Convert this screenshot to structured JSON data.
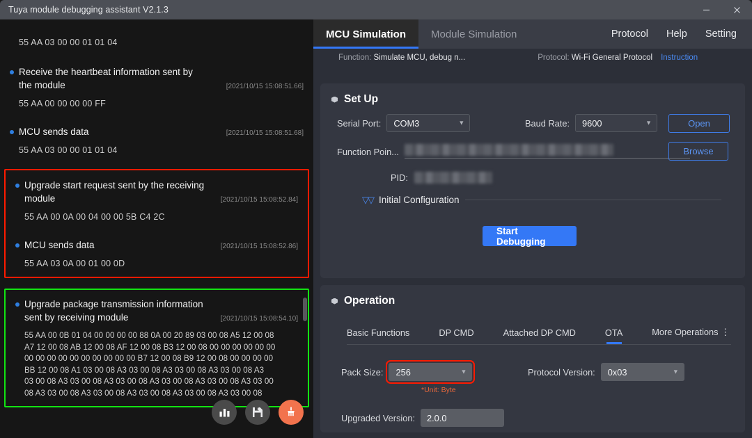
{
  "window": {
    "title": "Tuya module debugging assistant V2.1.3",
    "minimize_label": "minimize",
    "close_label": "close"
  },
  "log": {
    "entries": [
      {
        "type": "data-only",
        "body": "55 AA 03 00 00 01 01 04",
        "highlight": "none"
      },
      {
        "type": "entry",
        "head": "Receive the heartbeat information sent by the module",
        "timestamp": "[2021/10/15 15:08:51.66]",
        "body": "55 AA 00 00 00 00 FF",
        "highlight": "none"
      },
      {
        "type": "entry",
        "head": "MCU sends data",
        "timestamp": "[2021/10/15 15:08:51.68]",
        "body": "55 AA 03 00 00 01 01 04",
        "highlight": "none"
      },
      {
        "type": "entry",
        "head": "Upgrade start request sent by the receiving module",
        "timestamp": "[2021/10/15 15:08:52.84]",
        "body": "55 AA 00 0A 00 04 00 00 5B C4 2C",
        "highlight": "red"
      },
      {
        "type": "entry",
        "head": "MCU sends data",
        "timestamp": "[2021/10/15 15:08:52.86]",
        "body": "55 AA 03 0A 00 01 00 0D",
        "highlight": "red"
      },
      {
        "type": "entry",
        "head": "Upgrade package transmission information sent by receiving module",
        "timestamp": "[2021/10/15 15:08:54.10]",
        "body": "55 AA 00 0B 01 04 00 00 00 00 88 0A 00 20 89 03 00 08 A5 12 00 08\nA7 12 00 08 AB 12 00 08 AF 12 00 08 B3 12 00 08 00 00 00 00 00 00\n00 00 00 00 00 00 00 00 00 00 B7 12 00 08 B9 12 00 08 00 00 00 00\nBB 12 00 08 A1 03 00 08 A3 03 00 08 A3 03 00 08 A3 03 00 08 A3\n03 00 08 A3 03 00 08 A3 03 00 08 A3 03 00 08 A3 03 00 08 A3 03 00\n08 A3 03 00 08 A3 03 00 08 A3 03 00 08 A3 03 00 08 A3 03 00 08",
        "highlight": "green"
      }
    ],
    "highlight_colors": {
      "red": "#ff1a00",
      "green": "#12e312"
    },
    "actions": [
      {
        "name": "statistics",
        "icon": "bar-chart-icon",
        "label": "Statistics"
      },
      {
        "name": "save",
        "icon": "floppy-disk-icon",
        "label": "Save log"
      },
      {
        "name": "clear",
        "icon": "broom-icon",
        "label": "Clear log",
        "accent": "#f2734d"
      }
    ]
  },
  "right": {
    "tabs": [
      {
        "label": "MCU Simulation",
        "active": true
      },
      {
        "label": "Module Simulation",
        "active": false
      }
    ],
    "menu": [
      "Protocol",
      "Help",
      "Setting"
    ],
    "subbar": {
      "function_label": "Function:",
      "function_value": "Simulate MCU, debug n...",
      "protocol_label": "Protocol:",
      "protocol_value": "Wi-Fi General Protocol",
      "instruction_link": "Instruction"
    },
    "setup": {
      "title": "Set Up",
      "serial_port_label": "Serial Port:",
      "serial_port_value": "COM3",
      "baud_rate_label": "Baud Rate:",
      "baud_rate_value": "9600",
      "open_button": "Open",
      "function_point_label": "Function Poin...",
      "function_point_value": "",
      "browse_button": "Browse",
      "pid_label": "PID:",
      "pid_value": "",
      "initial_config_label": "Initial Configuration",
      "start_debugging_button": "Start Debugging"
    },
    "operation": {
      "title": "Operation",
      "tabs": [
        {
          "label": "Basic Functions",
          "active": false
        },
        {
          "label": "DP CMD",
          "active": false
        },
        {
          "label": "Attached DP CMD",
          "active": false
        },
        {
          "label": "OTA",
          "active": true
        },
        {
          "label": "More Operations ⋮",
          "active": false
        }
      ],
      "pack_size_label": "Pack Size:",
      "pack_size_value": "256",
      "pack_size_note": "*Unit: Byte",
      "protocol_version_label": "Protocol Version:",
      "protocol_version_value": "0x03",
      "upgraded_version_label": "Upgraded Version:",
      "upgraded_version_value": "2.0.0"
    }
  },
  "colors": {
    "accent_blue": "#3478f6",
    "link_blue": "#4a8bf5",
    "orange": "#f2734d",
    "note_orange": "#e8683c",
    "highlight_red": "#ff1a00",
    "highlight_green": "#12e312"
  }
}
